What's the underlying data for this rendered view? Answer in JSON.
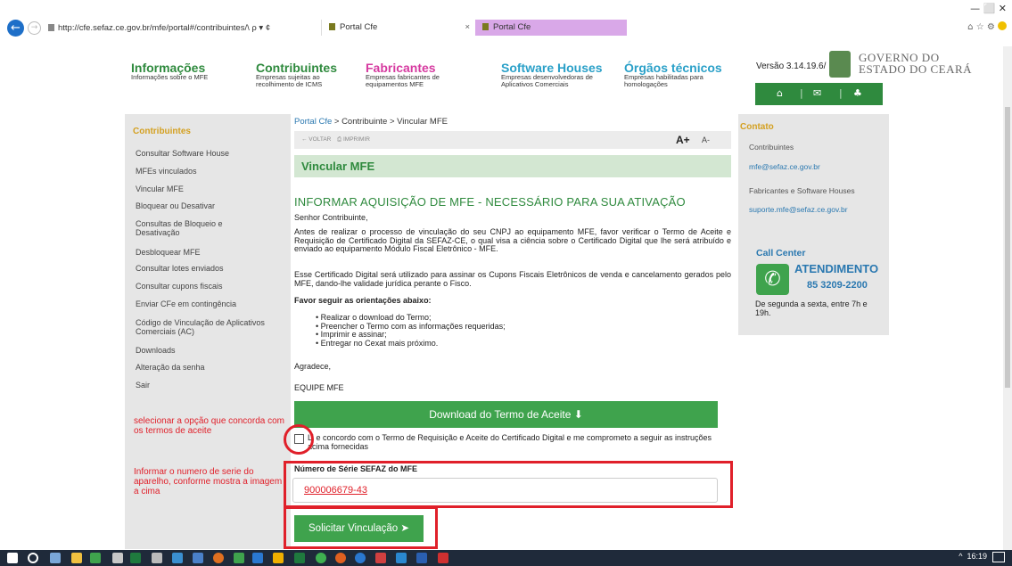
{
  "browser": {
    "url": "http://cfe.sefaz.ce.gov.br/mfe/portal#/contribuintes/\\",
    "url_controls": "ρ ▾ ¢",
    "tabs": [
      {
        "label": "Portal Cfe",
        "close": "×"
      },
      {
        "label": "Portal Cfe"
      }
    ],
    "window_controls": "—   ⬜   ✕"
  },
  "header": {
    "nav": [
      {
        "title": "Informações",
        "subtitle": "Informações sobre o MFE"
      },
      {
        "title": "Contribuintes",
        "subtitle": "Empresas sujeitas ao recolhimento de ICMS"
      },
      {
        "title": "Fabricantes",
        "subtitle": "Empresas fabricantes de equipamentos MFE"
      },
      {
        "title": "Software Houses",
        "subtitle": "Empresas desenvolvedoras de Aplicativos Comerciais"
      },
      {
        "title": "Órgãos técnicos",
        "subtitle": "Empresas habilitadas para homologações"
      }
    ],
    "versao": "Versão 3.14.19.6/",
    "gov_line1": "GOVERNO DO",
    "gov_line2": "ESTADO DO CEARÁ"
  },
  "sidebar": {
    "title": "Contribuintes",
    "items": [
      "Consultar Software House",
      "MFEs vinculados",
      "Vincular MFE",
      "Bloquear ou Desativar",
      "Consultas de Bloqueio e Desativação",
      "Desbloquear MFE",
      "Consultar lotes enviados",
      "Consultar cupons fiscais",
      "Enviar CFe em contingência",
      "Código de Vinculação de Aplicativos Comerciais (AC)",
      "Downloads",
      "Alteração da senha",
      "Sair"
    ],
    "annotation1": "selecionar a opção que concorda com os termos de aceite",
    "annotation2": "Informar o numero de serie do aparelho, conforme mostra a imagem a cima"
  },
  "main": {
    "breadcrumb_1": "Portal Cfe",
    "breadcrumb_2": " > Contribuinte > ",
    "breadcrumb_3": "Vincular MFE",
    "voltar": "← VOLTAR",
    "imprimir": "⎙ IMPRIMIR",
    "font_up": "A+",
    "font_down": "A-",
    "title": "Vincular MFE",
    "heading": "INFORMAR AQUISIÇÃO DE MFE - NECESSÁRIO PARA SUA ATIVAÇÃO",
    "greeting": "Senhor Contribuinte,",
    "para1": "Antes de realizar o processo de vinculação do seu CNPJ ao equipamento MFE, favor verificar o Termo de Aceite e Requisição de Certificado Digital da SEFAZ-CE, o qual visa a ciência sobre o Certificado Digital que lhe será atribuído e enviado ao equipamento Módulo Fiscal Eletrônico - MFE.",
    "para2": "Esse Certificado Digital será utilizado para assinar os Cupons Fiscais Eletrônicos de venda e cancelamento gerados pelo MFE, dando-lhe validade jurídica perante o Fisco.",
    "steps_title": "Favor seguir as orientações abaixo:",
    "steps": [
      "Realizar o download do Termo;",
      "Preencher o Termo com as informações requeridas;",
      "Imprimir e assinar;",
      "Entregar no Cexat mais próximo."
    ],
    "thanks": "Agradece,",
    "team": "EQUIPE MFE",
    "download_button": "Download do Termo de Aceite ⬇",
    "checkbox_label": "Li e concordo com o Termo de Requisição e Aceite do Certificado Digital e me comprometo a seguir as instruções acima fornecidas",
    "serial_label": "Número de Série SEFAZ do MFE",
    "serial_value": "900006679-43",
    "submit_button": "Solicitar Vinculação ➤"
  },
  "contact": {
    "title": "Contato",
    "contribuintes_label": "Contribuintes",
    "contribuintes_email": "mfe@sefaz.ce.gov.br",
    "fabricantes_label": "Fabricantes e Software Houses",
    "fabricantes_email": "suporte.mfe@sefaz.ce.gov.br",
    "callcenter_title": "Call Center",
    "atendimento": "ATENDIMENTO",
    "phone": "85 3209-2200",
    "hours": "De segunda a sexta, entre 7h e 19h."
  },
  "taskbar": {
    "clock": "16:19",
    "tray_arrow": "^"
  }
}
